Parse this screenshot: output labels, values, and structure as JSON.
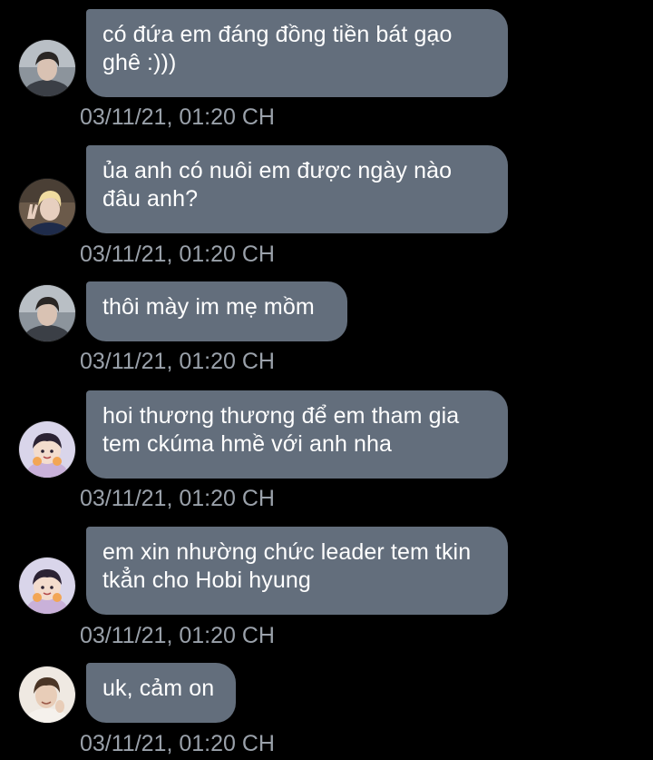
{
  "messages": [
    {
      "avatar": "dark-haired-boy-avatar",
      "lines": [
        "có đứa em đáng đồng tiền bát gạo",
        "ghê :)))"
      ],
      "timestamp": "03/11/21, 01:20 CH"
    },
    {
      "avatar": "blonde-peace-sign-avatar",
      "lines": [
        "ủa anh có nuôi em được ngày nào",
        "đâu anh?"
      ],
      "timestamp": "03/11/21, 01:20 CH"
    },
    {
      "avatar": "dark-haired-boy-avatar",
      "lines": [
        "thôi mày im mẹ mồm"
      ],
      "timestamp": "03/11/21, 01:20 CH"
    },
    {
      "avatar": "cartoon-boy-avatar",
      "lines": [
        "hoi thương thương để em tham gia",
        "tem ckúma hmề với anh nha"
      ],
      "timestamp": "03/11/21, 01:20 CH"
    },
    {
      "avatar": "cartoon-boy-avatar",
      "lines": [
        "em xin nhường chức leader tem tkin",
        "tkẳn cho Hobi hyung"
      ],
      "timestamp": "03/11/21, 01:20 CH"
    },
    {
      "avatar": "smiling-boy-avatar",
      "lines": [
        "uk, cảm on"
      ],
      "timestamp": "03/11/21, 01:20 CH"
    }
  ],
  "colors": {
    "background": "#000000",
    "bubble": "#636e7c",
    "text": "#ffffff",
    "timestamp": "#9aa1aa"
  }
}
